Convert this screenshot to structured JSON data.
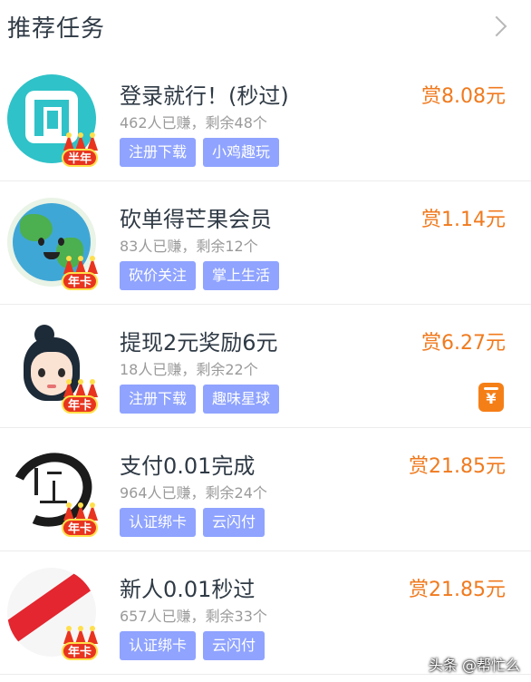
{
  "header": {
    "title": "推荐任务"
  },
  "tasks": [
    {
      "name": "登录就行！(秒过)",
      "stats": "462人已赚，剩余48个",
      "tags": [
        "注册下载",
        "小鸡趣玩"
      ],
      "reward": "赏8.08元",
      "badge": "半年",
      "icon": "xian-app-icon"
    },
    {
      "name": "砍单得芒果会员",
      "stats": "83人已赚，剩余12个",
      "tags": [
        "砍价关注",
        "掌上生活"
      ],
      "reward": "赏1.14元",
      "badge": "年卡",
      "icon": "earth-mascot-icon"
    },
    {
      "name": "提现2元奖励6元",
      "stats": "18人已赚，剩余22个",
      "tags": [
        "注册下载",
        "趣味星球"
      ],
      "reward": "赏6.27元",
      "badge": "年卡",
      "icon": "girl-avatar-icon",
      "wallet": "¥"
    },
    {
      "name": "支付0.01完成",
      "stats": "964人已赚，剩余24个",
      "tags": [
        "认证绑卡",
        "云闪付"
      ],
      "reward": "赏21.85元",
      "badge": "年卡",
      "icon": "ink-calligraphy-icon"
    },
    {
      "name": "新人0.01秒过",
      "stats": "657人已赚，剩余33个",
      "tags": [
        "认证绑卡",
        "云闪付"
      ],
      "reward": "赏21.85元",
      "badge": "年卡",
      "icon": "shop-recommend-icon"
    }
  ],
  "watermark": "头条 @帮忙么",
  "colors": {
    "reward": "#f07a1e",
    "tag": "#8fa3ff",
    "badge": "#e8341f"
  }
}
